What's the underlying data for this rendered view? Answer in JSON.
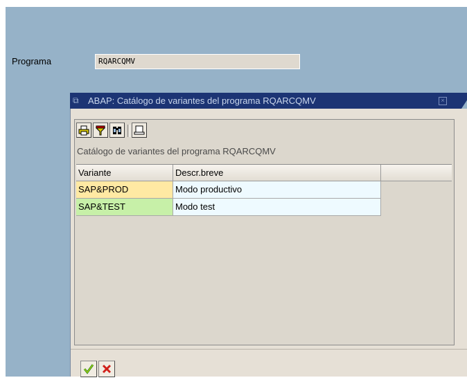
{
  "screen": {
    "programa_label": "Programa",
    "programa_value": "RQARCQMV"
  },
  "dialog": {
    "title": "ABAP: Catálogo de variantes del programa RQARCQMV",
    "catalog_title": "Catálogo de variantes del programa RQARCQMV",
    "columns": [
      "Variante",
      "Descr.breve"
    ],
    "rows": [
      {
        "variante": "SAP&PROD",
        "descr": "Modo productivo",
        "variant_color": "#ffe9a3"
      },
      {
        "variante": "SAP&TEST",
        "descr": "Modo test",
        "variant_color": "#c7f0a8"
      }
    ],
    "toolbar_icons": [
      "print-icon",
      "filter-icon",
      "find-icon",
      "page-icon"
    ],
    "footer_icons": [
      "confirm-check-icon",
      "cancel-x-icon"
    ]
  },
  "colors": {
    "title_bar": "#1c3474",
    "background": "#96b2c8",
    "dialog_body": "#e6e0d6",
    "desc_cell": "#eefaff",
    "confirm": "#3a9a1a",
    "cancel": "#d0201a"
  }
}
